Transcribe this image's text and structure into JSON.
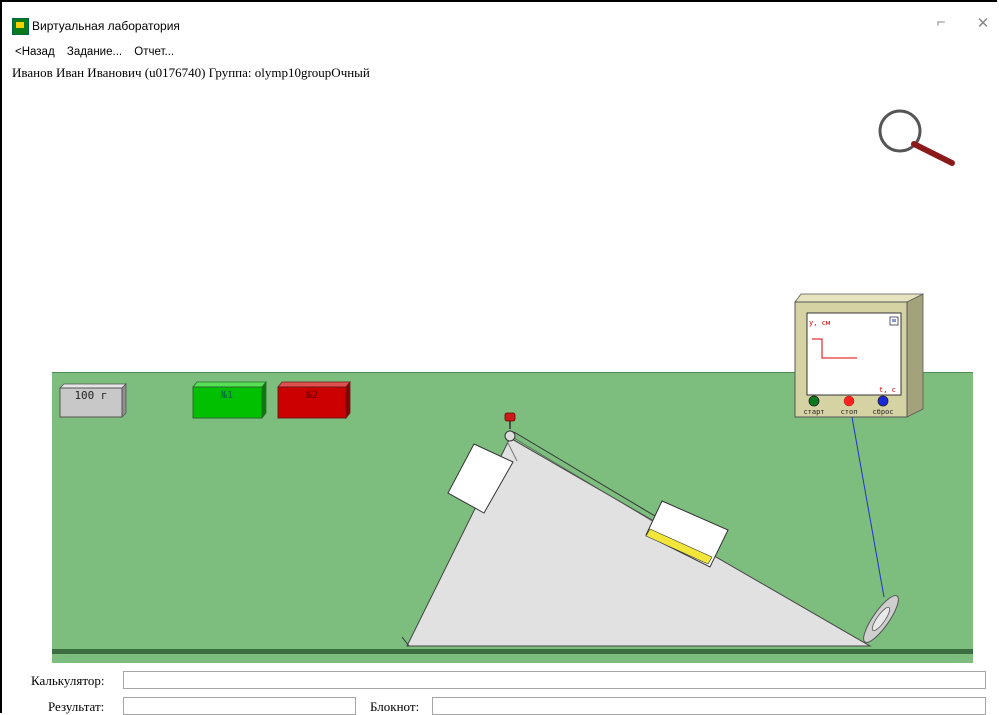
{
  "window": {
    "title": "Виртуальная лаборатория",
    "minimize_glyph": "⌐",
    "close_glyph": "✕"
  },
  "menu": {
    "back": "<Назад",
    "task": "Задание...",
    "report": "Отчет..."
  },
  "user": {
    "info": "Иванов Иван Иванович (u0176740)  Группа: olymp10groupОчный"
  },
  "scene": {
    "weight_label": "100 г",
    "block1_label": "№1",
    "block2_label": "№2",
    "magnifier_icon": "magnifier-icon",
    "meter": {
      "y_axis": "y, см",
      "t_axis": "t, с",
      "start": "старт",
      "stop": "стоп",
      "reset": "сброс"
    },
    "colors": {
      "table": "#7dbd7e",
      "block1": "#00c000",
      "block2": "#cc0000",
      "meter_case": "#d5d2a3",
      "plot_line": "#e00000"
    }
  },
  "bottom": {
    "calculator_label": "Калькулятор:",
    "calculator_value": "",
    "result_label": "Результат:",
    "result_value": "",
    "notepad_label": "Блокнот:",
    "notepad_value": ""
  }
}
